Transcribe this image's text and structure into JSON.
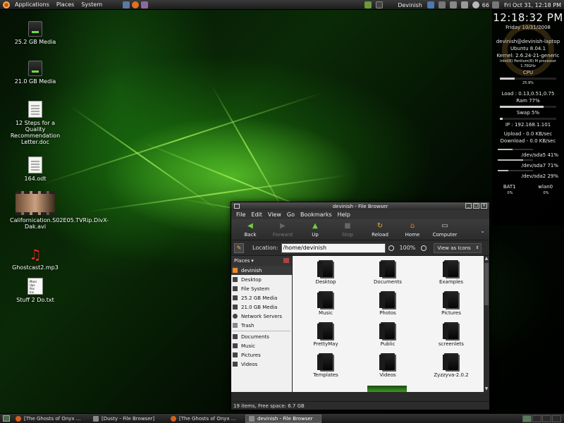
{
  "top_panel": {
    "menu": [
      "Applications",
      "Places",
      "System"
    ],
    "user": "Devinish",
    "battery": "66",
    "clock": "Fri Oct 31, 12:18 PM"
  },
  "conky": {
    "time": "12:18:32 PM",
    "date": "Friday 10/31/2008",
    "host": "devinish@devinish-laptop",
    "os": "Ubuntu 8.04.1",
    "kernel": "Kernel: 2.6.24-21-generic",
    "cpu_model": "Intel(R) Pentium(R) M processor",
    "cpu_speed": "1.70GHz",
    "cpu_label": "CPU",
    "cpu_usage": "25.9%",
    "load": "Load : 0.13,0.51,0.75",
    "ram": "Ram 77%",
    "swap": "Swap 5%",
    "ip": "IP : 192.168.1.101",
    "upload": "Upload - 0.0 KB/sec",
    "download": "Download - 0.0 KB/sec",
    "disks": [
      {
        "name": "/dev/sda5",
        "pct": "41%",
        "value": 0.41
      },
      {
        "name": "/dev/sda7",
        "pct": "71%",
        "value": 0.71
      },
      {
        "name": "/dev/sda2",
        "pct": "29%",
        "value": 0.29
      }
    ],
    "bat_label": "BAT1",
    "bat_value": "0%",
    "wlan_label": "wlan0",
    "wlan_value": "0%",
    "cpu_fill": 0.259,
    "ram_fill": 0.77,
    "swap_fill": 0.05
  },
  "desktop_icons": [
    {
      "label": "25.2 GB Media",
      "icon": "drive-icon"
    },
    {
      "label": "21.0 GB Media",
      "icon": "drive-icon"
    },
    {
      "label": "12 Steps for a Quality Recommendation Letter.doc",
      "icon": "document-icon"
    },
    {
      "label": "164.odt",
      "icon": "document-icon"
    },
    {
      "label": "Californication.S02E05.TVRip.DivX-Dak.avi",
      "icon": "video-icon"
    },
    {
      "label": "Ghostcast2.mp3",
      "icon": "music-icon"
    },
    {
      "label": "Stuff 2 Do.txt",
      "icon": "text-file-icon"
    }
  ],
  "txt_preview": "Macs\nUps\nPos\nIns",
  "window": {
    "title": "devinish - File Browser",
    "menu": [
      "File",
      "Edit",
      "View",
      "Go",
      "Bookmarks",
      "Help"
    ],
    "toolbar": {
      "back": "Back",
      "forward": "Forward",
      "up": "Up",
      "stop": "Stop",
      "reload": "Reload",
      "home": "Home",
      "computer": "Computer"
    },
    "location_label": "Location:",
    "location_value": "/home/devinish",
    "zoom": "100%",
    "view_mode": "View as Icons",
    "places_label": "Places",
    "sidebar": [
      {
        "label": "devinish",
        "selected": true
      },
      {
        "label": "Desktop"
      },
      {
        "label": "File System"
      },
      {
        "label": "25.2 GB Media"
      },
      {
        "label": "21.0 GB Media"
      },
      {
        "label": "Network Servers"
      },
      {
        "label": "Trash"
      }
    ],
    "bookmarks": [
      "Documents",
      "Music",
      "Pictures",
      "Videos"
    ],
    "files": [
      "Desktop",
      "Documents",
      "Examples",
      "Music",
      "Photos",
      "Pictures",
      "PrettyMay",
      "Public",
      "screenlets",
      "Templates",
      "Videos",
      "Zyzzyva-2.0.2"
    ],
    "status": "19 items, Free space: 6.7 GB"
  },
  "taskbar": [
    {
      "label": "[The Ghosts of Onyx ...",
      "active": false
    },
    {
      "label": "[Dusty - File Browser]",
      "active": false
    },
    {
      "label": "[The Ghosts of Onyx ...",
      "active": false
    },
    {
      "label": "devinish - File Browser",
      "active": true
    }
  ]
}
